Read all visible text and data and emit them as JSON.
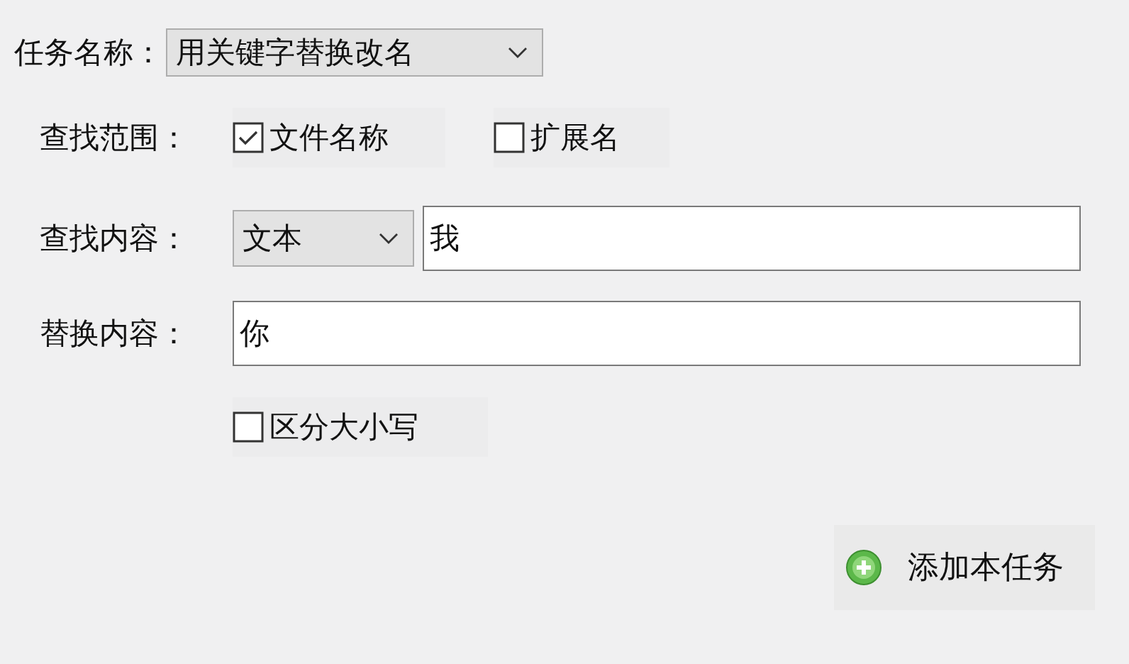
{
  "task": {
    "label": "任务名称：",
    "value": "用关键字替换改名"
  },
  "scope": {
    "label": "查找范围：",
    "options": [
      {
        "label": "文件名称",
        "checked": true
      },
      {
        "label": "扩展名",
        "checked": false
      }
    ]
  },
  "find": {
    "label": "查找内容：",
    "mode": "文本",
    "value": "我"
  },
  "replace": {
    "label": "替换内容：",
    "value": "你"
  },
  "case_sensitive": {
    "label": "区分大小写",
    "checked": false
  },
  "add_button": {
    "label": "添加本任务"
  }
}
